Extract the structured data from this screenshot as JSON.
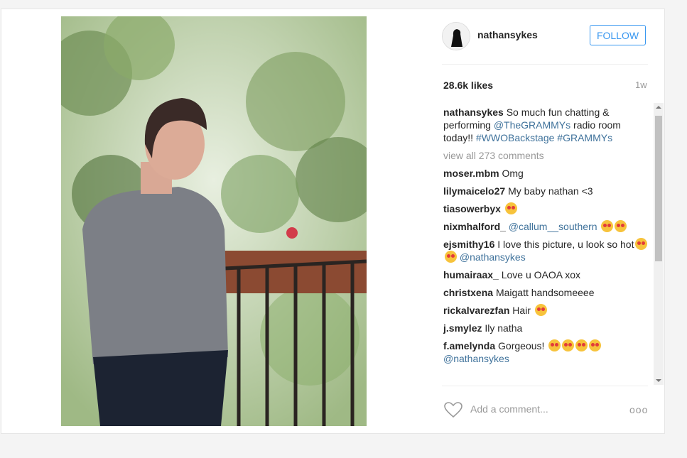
{
  "header": {
    "username": "nathansykes",
    "follow_label": "FOLLOW"
  },
  "stats": {
    "likes": "28.6k likes",
    "time": "1w"
  },
  "caption": {
    "user": "nathansykes",
    "text": "So much fun chatting & performing ",
    "mention": "@TheGRAMMYs",
    "text2": " radio room today!! ",
    "hashtags": "#WWOBackstage #GRAMMYs"
  },
  "view_all": "view all 273 comments",
  "comments": [
    {
      "user": "moser.mbm",
      "text": "Omg"
    },
    {
      "user": "lilymaicelo27",
      "text": "My baby nathan <3"
    },
    {
      "user": "tiasowerbyx",
      "text": ""
    },
    {
      "user": "nixmhalford_",
      "mention": "@callum__southern",
      "text": ""
    },
    {
      "user": "ejsmithy16",
      "text": "I love this picture, u look so hot",
      "mention": "@nathansykes"
    },
    {
      "user": "humairaax_",
      "text": "Love u OAOA xox"
    },
    {
      "user": "christxena",
      "text": "Maigatt handsomeeee"
    },
    {
      "user": "rickalvarezfan",
      "text": "Hair"
    },
    {
      "user": "j.smylez",
      "text": "Ily natha"
    },
    {
      "user": "f.amelynda",
      "text": "Gorgeous!",
      "mention": "@nathansykes"
    }
  ],
  "footer": {
    "placeholder": "Add a comment...",
    "more": "ooo"
  },
  "icons": {
    "heart": "heart-icon",
    "more": "more-options-icon"
  }
}
